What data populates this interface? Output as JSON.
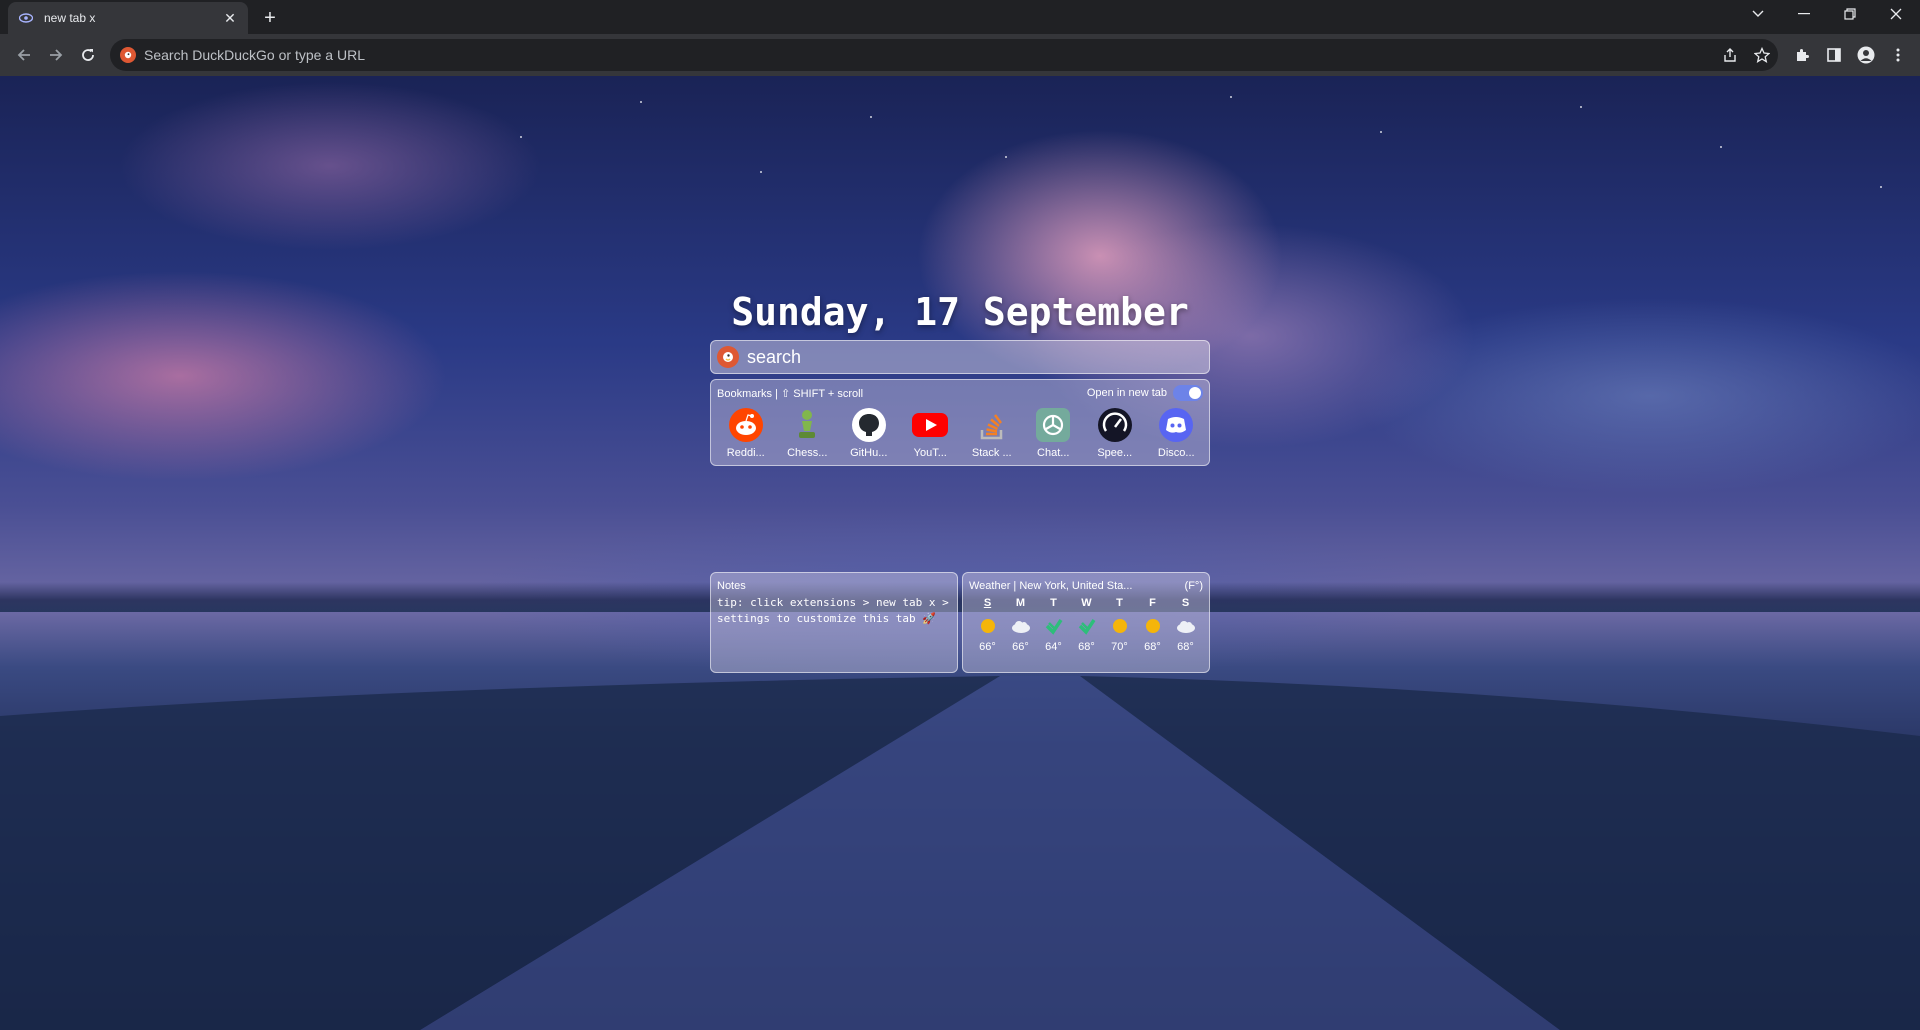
{
  "browser": {
    "tab_title": "new tab x",
    "new_tab_symbol": "+",
    "omnibox_placeholder": "Search DuckDuckGo or type a URL",
    "search_engine_icon": "duckduckgo-icon"
  },
  "page": {
    "date_heading": "Sunday, 17 September",
    "search_placeholder": "search",
    "bookmarks": {
      "header": "Bookmarks | ⇧ SHIFT + scroll",
      "open_new_tab_label": "Open in new tab",
      "open_new_tab_on": true,
      "items": [
        {
          "label": "Reddi...",
          "icon": "reddit-icon",
          "color": "#ff4500"
        },
        {
          "label": "Chess...",
          "icon": "chess-icon",
          "color": "#7fa650"
        },
        {
          "label": "GitHu...",
          "icon": "github-icon",
          "color": "#ffffff"
        },
        {
          "label": "YouT...",
          "icon": "youtube-icon",
          "color": "#ff0000"
        },
        {
          "label": "Stack ...",
          "icon": "stackoverflow-icon",
          "color": "#f48024"
        },
        {
          "label": "Chat...",
          "icon": "chatgpt-icon",
          "color": "#74aa9c"
        },
        {
          "label": "Spee...",
          "icon": "speedtest-icon",
          "color": "#141526"
        },
        {
          "label": "Disco...",
          "icon": "discord-icon",
          "color": "#5865f2"
        }
      ]
    },
    "notes": {
      "title": "Notes",
      "body": "tip: click extensions > new tab x > settings to customize this tab 🚀"
    },
    "weather": {
      "title": "Weather | New York, United Sta...",
      "unit": "(F°)",
      "days": [
        {
          "day": "S",
          "icon": "sun-icon",
          "temp": "66°"
        },
        {
          "day": "M",
          "icon": "cloud-icon",
          "temp": "66°"
        },
        {
          "day": "T",
          "icon": "rain-icon",
          "temp": "64°"
        },
        {
          "day": "W",
          "icon": "rain-icon",
          "temp": "68°"
        },
        {
          "day": "T",
          "icon": "sun-icon",
          "temp": "70°"
        },
        {
          "day": "F",
          "icon": "sun-icon",
          "temp": "68°"
        },
        {
          "day": "S",
          "icon": "cloud-icon",
          "temp": "68°"
        }
      ]
    }
  }
}
